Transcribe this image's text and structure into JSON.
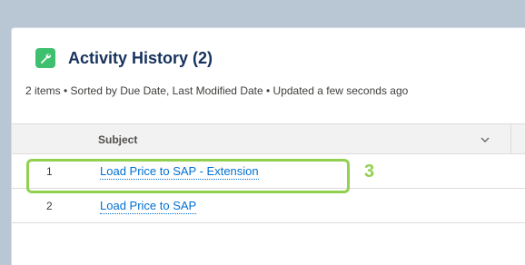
{
  "card": {
    "title": "Activity History (2)",
    "meta": "2 items • Sorted by Due Date, Last Modified Date • Updated a few seconds ago",
    "icon": "wrench-icon"
  },
  "table": {
    "columns": [
      "Subject"
    ],
    "rows": [
      {
        "num": "1",
        "subject": "Load Price to SAP - Extension"
      },
      {
        "num": "2",
        "subject": "Load Price to SAP"
      }
    ]
  },
  "annotation": {
    "label": "3",
    "color": "#92d050"
  },
  "colors": {
    "link": "#0070d2",
    "icon_bg": "#3ec06f",
    "title": "#16325c"
  }
}
